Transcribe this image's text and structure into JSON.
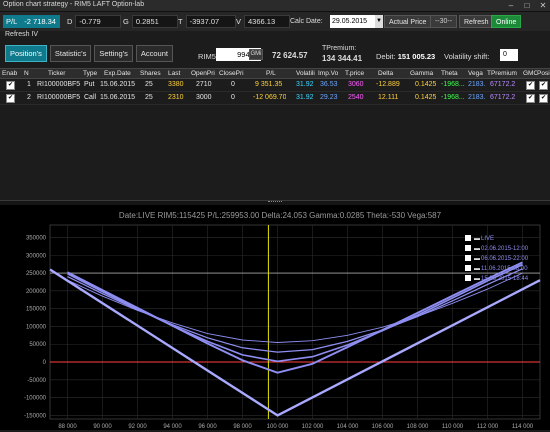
{
  "window": {
    "title": "Option chart strategy - RIM5 LAFT Option-lab",
    "minimize": "–",
    "maximize": "□",
    "close": "✕"
  },
  "toolbar": {
    "pl_label": "P/L",
    "pl_value": "-2 718.34",
    "d_label": "D",
    "d_value": "-0.779",
    "g_label": "G",
    "g_value": "0.2851",
    "t_label": "T",
    "t_value": "-3937.07",
    "v_label": "V",
    "v_value": "4366.13",
    "calc_date_label": "Calc Date:",
    "calc_date": "29.05.2015",
    "actual_price": "Actual Price",
    "dash_value": "--30--",
    "refresh": "Refresh",
    "online": "Online",
    "refresh_iv": "Refresh IV"
  },
  "tabs": [
    "Position's",
    "Statistic's",
    "Setting's",
    "Account"
  ],
  "underlying": {
    "label": "RIM5",
    "value": "99480",
    "gmi_label": "GMi",
    "gmi_value": "72 624.57",
    "tpremium_label": "TPremium:",
    "tpremium_value": "134 344.41",
    "debit_label": "Debit:",
    "debit_value": "151 005.23",
    "vol_shift_label": "Volatility shift:",
    "vol_shift_value": "0"
  },
  "table": {
    "headers": [
      "Enab",
      "N",
      "Ticker",
      "Type",
      "Exp.Date",
      "Shares",
      "Last",
      "OpenPri",
      "ClosePri",
      "P/L",
      "Volatili",
      "Imp.Vo",
      "T.price",
      "Delta",
      "Gamma",
      "Theta",
      "Vega",
      "TPremium",
      "GMO",
      "Posi"
    ],
    "rows": [
      {
        "n": "1",
        "ticker": "RI100000BF5",
        "type": "Put",
        "exp": "15.06.2015",
        "shares": "25",
        "last": "3380",
        "open": "2710",
        "close": "0",
        "pl": "9 351.35",
        "vol": "31.92",
        "impvol": "36.53",
        "tprice": "3060",
        "delta": "-12.889",
        "gamma": "0.1425",
        "theta": "-1968...",
        "vega": "2183...",
        "tpremium": "67172.2"
      },
      {
        "n": "2",
        "ticker": "RI100000BF5",
        "type": "Call",
        "exp": "15.06.2015",
        "shares": "25",
        "last": "2310",
        "open": "3000",
        "close": "0",
        "pl": "-12 069.70",
        "vol": "31.92",
        "impvol": "29.23",
        "tprice": "2540",
        "delta": "12.111",
        "gamma": "0.1425",
        "theta": "-1968...",
        "vega": "2183...",
        "tpremium": "67172.2"
      }
    ]
  },
  "chart_header": "Date:LIVE  RIM5:115425  P/L:259953.00  Delta:24.053  Gamma:0.0285  Theta:-530  Vega:587",
  "legend": [
    "LIVE",
    "02.06.2015-12:00",
    "06.06.2015-22:00",
    "11.06.2015-08:00",
    "15.06.2015-18:44"
  ],
  "chart_data": {
    "type": "line",
    "xlabel": "",
    "ylabel": "",
    "xlim": [
      87000,
      115000
    ],
    "ylim": [
      -160000,
      385000
    ],
    "x_ticks": [
      "88 000",
      "90 000",
      "92 000",
      "94 000",
      "96 000",
      "98 000",
      "100 000",
      "102 000",
      "104 000",
      "106 000",
      "108 000",
      "110 000",
      "112 000",
      "114 000"
    ],
    "y_ticks": [
      "350000",
      "300000",
      "250000",
      "200000",
      "150000",
      "100000",
      "50000",
      "0",
      "-50000",
      "-100000",
      "-150000"
    ],
    "cursor_x": 99480,
    "horizontal_lines": [
      0,
      250000
    ],
    "series": [
      {
        "name": "LIVE",
        "x": [
          88000,
          90000,
          92000,
          94000,
          96000,
          98000,
          100000,
          102000,
          104000,
          106000,
          108000,
          110000,
          112000,
          114000
        ],
        "values": [
          230000,
          185000,
          145000,
          110000,
          80000,
          62000,
          55000,
          60000,
          75000,
          98000,
          128000,
          165000,
          205000,
          250000
        ]
      },
      {
        "name": "02.06.2015-12:00",
        "x": [
          88000,
          90000,
          92000,
          94000,
          96000,
          98000,
          100000,
          102000,
          104000,
          106000,
          108000,
          110000,
          112000,
          114000
        ],
        "values": [
          240000,
          192000,
          147000,
          105000,
          68000,
          40000,
          28000,
          35000,
          58000,
          90000,
          128000,
          172000,
          218000,
          262000
        ]
      },
      {
        "name": "06.06.2015-22:00",
        "x": [
          88000,
          90000,
          92000,
          94000,
          96000,
          98000,
          100000,
          102000,
          104000,
          106000,
          108000,
          110000,
          112000,
          114000
        ],
        "values": [
          248000,
          198000,
          149000,
          102000,
          58000,
          20000,
          2000,
          15000,
          48000,
          88000,
          132000,
          180000,
          228000,
          274000
        ]
      },
      {
        "name": "11.06.2015-08:00",
        "x": [
          88000,
          90000,
          92000,
          94000,
          96000,
          98000,
          100000,
          102000,
          104000,
          106000,
          108000,
          110000,
          112000,
          114000
        ],
        "values": [
          252000,
          202000,
          152000,
          102000,
          52000,
          5000,
          -30000,
          -5000,
          42000,
          90000,
          138000,
          186000,
          234000,
          280000
        ]
      },
      {
        "name": "15.06.2015-18:44",
        "x": [
          87000,
          100000,
          115000
        ],
        "values": [
          260000,
          -150000,
          230000
        ]
      }
    ]
  },
  "colors": {
    "accent": "#0e7a8c",
    "online": "#1d8a3a",
    "curve": "#8e8ef2",
    "expiry_curve": "#a9a9ff",
    "zero_line": "#ff4040",
    "cursor_line": "#e6e600"
  }
}
